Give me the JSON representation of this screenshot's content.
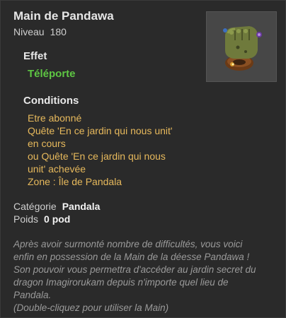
{
  "item": {
    "name": "Main de Pandawa",
    "level_label": "Niveau",
    "level_value": "180",
    "icon": "pandawa-hand-icon"
  },
  "effect": {
    "heading": "Effet",
    "text": "Téléporte"
  },
  "conditions": {
    "heading": "Conditions",
    "lines": [
      "Etre abonné",
      "Quête 'En ce jardin qui nous unit'",
      "en cours",
      "ou Quête 'En ce jardin qui nous",
      "unit' achevée",
      "Zone : Île de Pandala"
    ]
  },
  "meta": {
    "category_label": "Catégorie",
    "category_value": "Pandala",
    "weight_label": "Poids",
    "weight_value": "0 pod"
  },
  "description": {
    "lines": [
      "Après avoir surmonté nombre de difficultés, vous voici",
      "enfin en possession de la Main de la déesse Pandawa !",
      "Son pouvoir vous permettra d'accéder au jardin secret du",
      "dragon Imagirorukam depuis n'importe quel lieu de",
      "Pandala.",
      "(Double-cliquez pour utiliser la Main)"
    ]
  },
  "colors": {
    "background": "#2a2a2a",
    "effect_green": "#5ec643",
    "condition_gold": "#e7b95c",
    "description_grey": "#9a9a9a"
  }
}
